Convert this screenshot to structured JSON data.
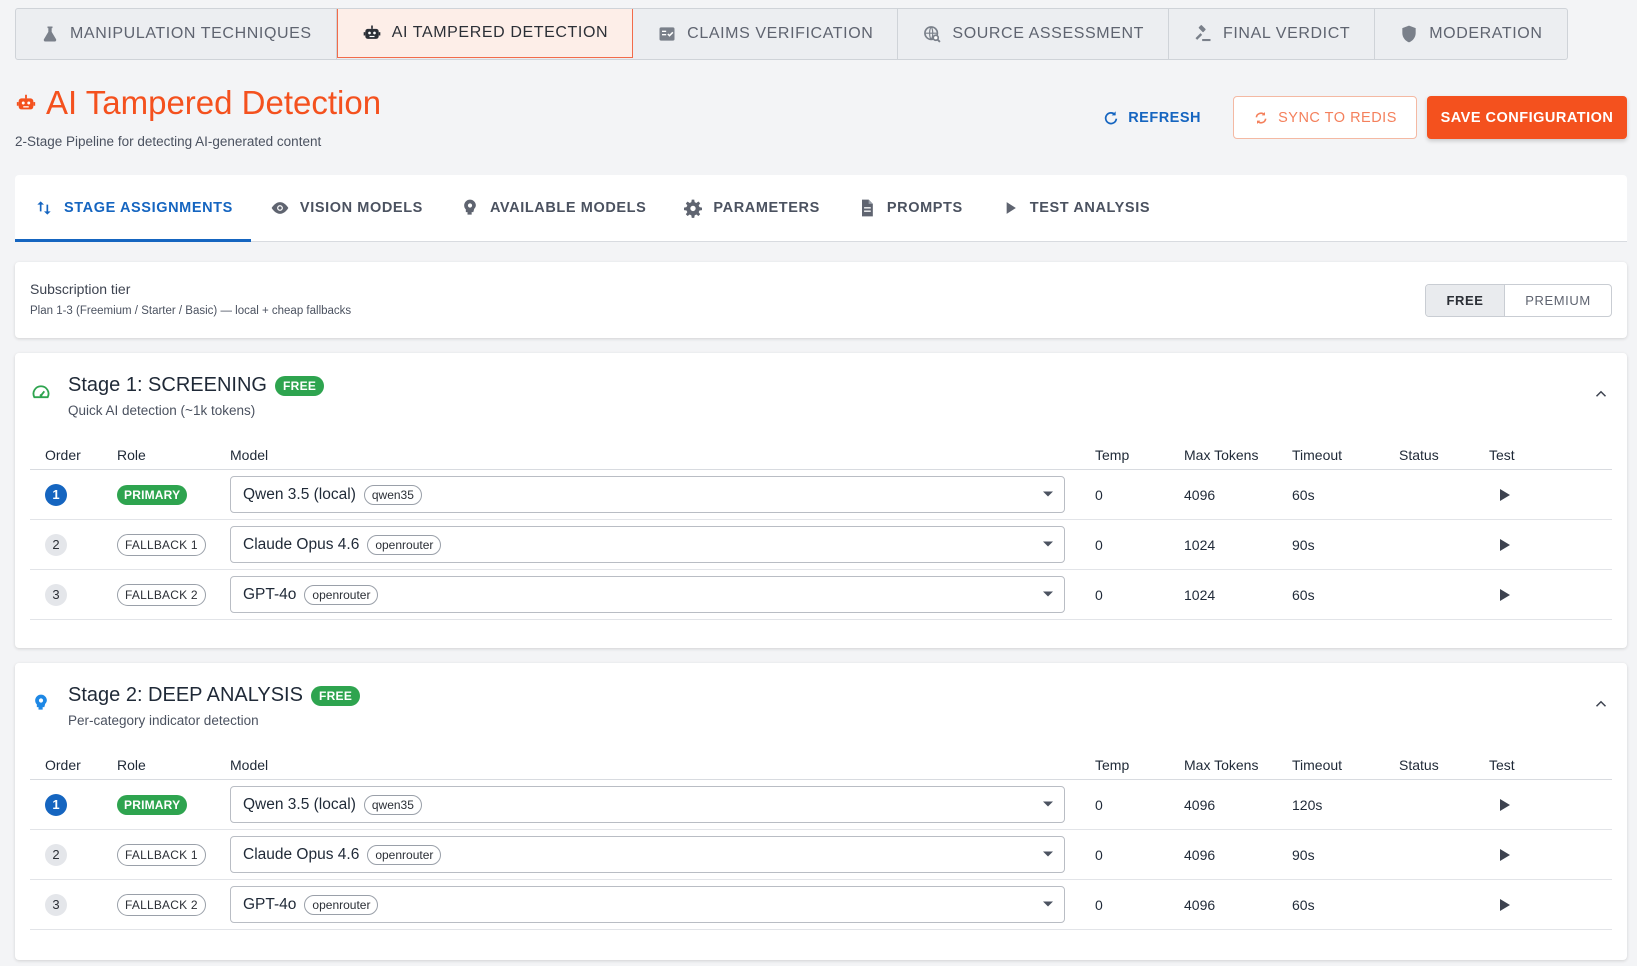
{
  "category_tabs": [
    {
      "label": "MANIPULATION TECHNIQUES",
      "icon": "flask-icon"
    },
    {
      "label": "AI TAMPERED DETECTION",
      "icon": "robot-icon",
      "active": true
    },
    {
      "label": "CLAIMS VERIFICATION",
      "icon": "fact-check-icon"
    },
    {
      "label": "SOURCE ASSESSMENT",
      "icon": "globe-search-icon"
    },
    {
      "label": "FINAL VERDICT",
      "icon": "gavel-icon"
    },
    {
      "label": "MODERATION",
      "icon": "shield-icon"
    }
  ],
  "header": {
    "title": "AI Tampered Detection",
    "subtitle": "2-Stage Pipeline for detecting AI-generated content",
    "refresh_label": "REFRESH",
    "sync_label": "SYNC TO REDIS",
    "save_label": "SAVE CONFIGURATION"
  },
  "sub_tabs": [
    {
      "label": "STAGE ASSIGNMENTS",
      "icon": "swap-vertical-icon",
      "active": true
    },
    {
      "label": "VISION MODELS",
      "icon": "eye-icon"
    },
    {
      "label": "AVAILABLE MODELS",
      "icon": "brain-icon"
    },
    {
      "label": "PARAMETERS",
      "icon": "gear-icon"
    },
    {
      "label": "PROMPTS",
      "icon": "document-icon"
    },
    {
      "label": "TEST ANALYSIS",
      "icon": "play-icon"
    }
  ],
  "subscription": {
    "label": "Subscription tier",
    "description": "Plan 1-3 (Freemium / Starter / Basic) — local + cheap fallbacks",
    "options": [
      "FREE",
      "PREMIUM"
    ],
    "selected": "FREE"
  },
  "columns": [
    "Order",
    "Role",
    "Model",
    "Temp",
    "Max Tokens",
    "Timeout",
    "Status",
    "Test"
  ],
  "stages": [
    {
      "title": "Stage 1: SCREENING",
      "badge": "FREE",
      "subtitle": "Quick AI detection (~1k tokens)",
      "icon": "speedometer-icon",
      "rows": [
        {
          "order": "1",
          "role": "PRIMARY",
          "model": "Qwen 3.5 (local)",
          "provider": "qwen35",
          "temp": "0",
          "max_tokens": "4096",
          "timeout": "60s"
        },
        {
          "order": "2",
          "role": "FALLBACK 1",
          "model": "Claude Opus 4.6",
          "provider": "openrouter",
          "temp": "0",
          "max_tokens": "1024",
          "timeout": "90s"
        },
        {
          "order": "3",
          "role": "FALLBACK 2",
          "model": "GPT-4o",
          "provider": "openrouter",
          "temp": "0",
          "max_tokens": "1024",
          "timeout": "60s"
        }
      ]
    },
    {
      "title": "Stage 2: DEEP ANALYSIS",
      "badge": "FREE",
      "subtitle": "Per-category indicator detection",
      "icon": "brain-icon",
      "rows": [
        {
          "order": "1",
          "role": "PRIMARY",
          "model": "Qwen 3.5 (local)",
          "provider": "qwen35",
          "temp": "0",
          "max_tokens": "4096",
          "timeout": "120s"
        },
        {
          "order": "2",
          "role": "FALLBACK 1",
          "model": "Claude Opus 4.6",
          "provider": "openrouter",
          "temp": "0",
          "max_tokens": "4096",
          "timeout": "90s"
        },
        {
          "order": "3",
          "role": "FALLBACK 2",
          "model": "GPT-4o",
          "provider": "openrouter",
          "temp": "0",
          "max_tokens": "4096",
          "timeout": "60s"
        }
      ]
    }
  ],
  "colors": {
    "accent": "#f4511e",
    "primary_blue": "#1565c0",
    "success_green": "#2ea44f"
  }
}
